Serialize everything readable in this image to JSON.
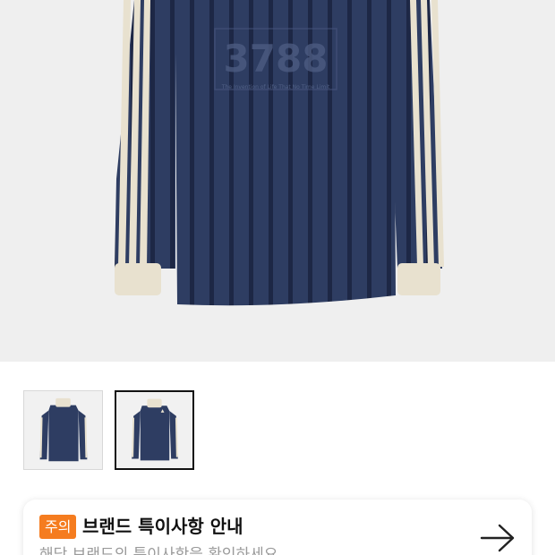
{
  "product": {
    "print_number": "3788",
    "print_tagline": "The Invention of Life That No Time Limit",
    "colors": {
      "navy": "#2b3a5c",
      "navy_dark": "#1b2540",
      "stripe_cream": "#e8e1cf",
      "background": "#efefef"
    }
  },
  "thumbnails": [
    {
      "label": "Front view",
      "active": false
    },
    {
      "label": "Front view with collar",
      "active": true
    }
  ],
  "notice": {
    "badge": "주의",
    "title": "브랜드 특이사항 안내",
    "subtitle": "해당 브랜드의 특이사항을 확인하세요",
    "arrow_icon": "arrow-right-icon",
    "badge_color": "#f57c1f"
  }
}
